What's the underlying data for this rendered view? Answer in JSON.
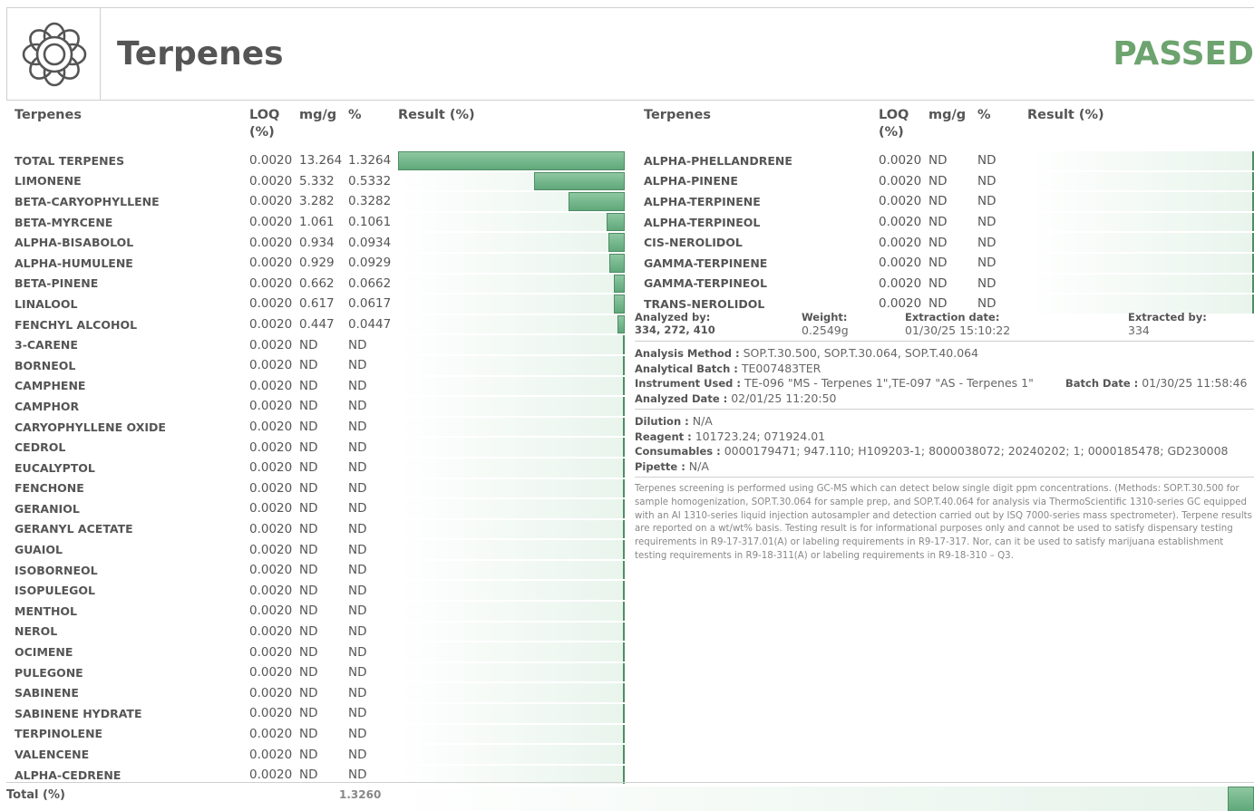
{
  "header": {
    "title": "Terpenes",
    "status": "PASSED",
    "status_color": "#6da36f",
    "icon": "flower-icon"
  },
  "columns": {
    "name": "Terpenes",
    "loq": "LOQ (%)",
    "mgg": "mg/g",
    "pct": "%",
    "result": "Result (%)"
  },
  "left_rows": [
    {
      "name": "TOTAL TERPENES",
      "loq": "0.0020",
      "mgg": "13.264",
      "pct": "1.3264",
      "result": 1.3264
    },
    {
      "name": "LIMONENE",
      "loq": "0.0020",
      "mgg": "5.332",
      "pct": "0.5332",
      "result": 0.5332
    },
    {
      "name": "BETA-CARYOPHYLLENE",
      "loq": "0.0020",
      "mgg": "3.282",
      "pct": "0.3282",
      "result": 0.3282
    },
    {
      "name": "BETA-MYRCENE",
      "loq": "0.0020",
      "mgg": "1.061",
      "pct": "0.1061",
      "result": 0.1061
    },
    {
      "name": "ALPHA-BISABOLOL",
      "loq": "0.0020",
      "mgg": "0.934",
      "pct": "0.0934",
      "result": 0.0934
    },
    {
      "name": "ALPHA-HUMULENE",
      "loq": "0.0020",
      "mgg": "0.929",
      "pct": "0.0929",
      "result": 0.0929
    },
    {
      "name": "BETA-PINENE",
      "loq": "0.0020",
      "mgg": "0.662",
      "pct": "0.0662",
      "result": 0.0662
    },
    {
      "name": "LINALOOL",
      "loq": "0.0020",
      "mgg": "0.617",
      "pct": "0.0617",
      "result": 0.0617
    },
    {
      "name": "FENCHYL ALCOHOL",
      "loq": "0.0020",
      "mgg": "0.447",
      "pct": "0.0447",
      "result": 0.0447
    },
    {
      "name": "3-CARENE",
      "loq": "0.0020",
      "mgg": "ND",
      "pct": "ND",
      "result": 0
    },
    {
      "name": "BORNEOL",
      "loq": "0.0020",
      "mgg": "ND",
      "pct": "ND",
      "result": 0
    },
    {
      "name": "CAMPHENE",
      "loq": "0.0020",
      "mgg": "ND",
      "pct": "ND",
      "result": 0
    },
    {
      "name": "CAMPHOR",
      "loq": "0.0020",
      "mgg": "ND",
      "pct": "ND",
      "result": 0
    },
    {
      "name": "CARYOPHYLLENE OXIDE",
      "loq": "0.0020",
      "mgg": "ND",
      "pct": "ND",
      "result": 0
    },
    {
      "name": "CEDROL",
      "loq": "0.0020",
      "mgg": "ND",
      "pct": "ND",
      "result": 0
    },
    {
      "name": "EUCALYPTOL",
      "loq": "0.0020",
      "mgg": "ND",
      "pct": "ND",
      "result": 0
    },
    {
      "name": "FENCHONE",
      "loq": "0.0020",
      "mgg": "ND",
      "pct": "ND",
      "result": 0
    },
    {
      "name": "GERANIOL",
      "loq": "0.0020",
      "mgg": "ND",
      "pct": "ND",
      "result": 0
    },
    {
      "name": "GERANYL ACETATE",
      "loq": "0.0020",
      "mgg": "ND",
      "pct": "ND",
      "result": 0
    },
    {
      "name": "GUAIOL",
      "loq": "0.0020",
      "mgg": "ND",
      "pct": "ND",
      "result": 0
    },
    {
      "name": "ISOBORNEOL",
      "loq": "0.0020",
      "mgg": "ND",
      "pct": "ND",
      "result": 0
    },
    {
      "name": "ISOPULEGOL",
      "loq": "0.0020",
      "mgg": "ND",
      "pct": "ND",
      "result": 0
    },
    {
      "name": "MENTHOL",
      "loq": "0.0020",
      "mgg": "ND",
      "pct": "ND",
      "result": 0
    },
    {
      "name": "NEROL",
      "loq": "0.0020",
      "mgg": "ND",
      "pct": "ND",
      "result": 0
    },
    {
      "name": "OCIMENE",
      "loq": "0.0020",
      "mgg": "ND",
      "pct": "ND",
      "result": 0
    },
    {
      "name": "PULEGONE",
      "loq": "0.0020",
      "mgg": "ND",
      "pct": "ND",
      "result": 0
    },
    {
      "name": "SABINENE",
      "loq": "0.0020",
      "mgg": "ND",
      "pct": "ND",
      "result": 0
    },
    {
      "name": "SABINENE HYDRATE",
      "loq": "0.0020",
      "mgg": "ND",
      "pct": "ND",
      "result": 0
    },
    {
      "name": "TERPINOLENE",
      "loq": "0.0020",
      "mgg": "ND",
      "pct": "ND",
      "result": 0
    },
    {
      "name": "VALENCENE",
      "loq": "0.0020",
      "mgg": "ND",
      "pct": "ND",
      "result": 0
    },
    {
      "name": "ALPHA-CEDRENE",
      "loq": "0.0020",
      "mgg": "ND",
      "pct": "ND",
      "result": 0
    }
  ],
  "right_rows": [
    {
      "name": "ALPHA-PHELLANDRENE",
      "loq": "0.0020",
      "mgg": "ND",
      "pct": "ND",
      "result": 0
    },
    {
      "name": "ALPHA-PINENE",
      "loq": "0.0020",
      "mgg": "ND",
      "pct": "ND",
      "result": 0
    },
    {
      "name": "ALPHA-TERPINENE",
      "loq": "0.0020",
      "mgg": "ND",
      "pct": "ND",
      "result": 0
    },
    {
      "name": "ALPHA-TERPINEOL",
      "loq": "0.0020",
      "mgg": "ND",
      "pct": "ND",
      "result": 0
    },
    {
      "name": "CIS-NEROLIDOL",
      "loq": "0.0020",
      "mgg": "ND",
      "pct": "ND",
      "result": 0
    },
    {
      "name": "GAMMA-TERPINENE",
      "loq": "0.0020",
      "mgg": "ND",
      "pct": "ND",
      "result": 0
    },
    {
      "name": "GAMMA-TERPINEOL",
      "loq": "0.0020",
      "mgg": "ND",
      "pct": "ND",
      "result": 0
    },
    {
      "name": "TRANS-NEROLIDOL",
      "loq": "0.0020",
      "mgg": "ND",
      "pct": "ND",
      "result": 0
    }
  ],
  "result_scale_max": 1.3264,
  "analysis": {
    "analyzed_by_label": "Analyzed by:",
    "analyzed_by": "334, 272, 410",
    "weight_label": "Weight:",
    "weight": "0.2549g",
    "extraction_date_label": "Extraction date:",
    "extraction_date": "01/30/25 15:10:22",
    "extracted_by_label": "Extracted by:",
    "extracted_by": "334"
  },
  "method": {
    "analysis_method_label": "Analysis Method :",
    "analysis_method": "SOP.T.30.500, SOP.T.30.064, SOP.T.40.064",
    "batch_label": "Analytical Batch :",
    "batch": "TE007483TER",
    "instrument_label": "Instrument Used :",
    "instrument": "TE-096 \"MS - Terpenes 1\",TE-097 \"AS - Terpenes 1\"",
    "batch_date_label": "Batch Date :",
    "batch_date": "01/30/25 11:58:46",
    "analyzed_date_label": "Analyzed Date :",
    "analyzed_date": "02/01/25 11:20:50"
  },
  "reagents": {
    "dilution_label": "Dilution :",
    "dilution": "N/A",
    "reagent_label": "Reagent :",
    "reagent": "101723.24; 071924.01",
    "consumables_label": "Consumables :",
    "consumables": "0000179471; 947.110; H109203-1; 8000038072; 20240202; 1; 0000185478; GD230008",
    "pipette_label": "Pipette :",
    "pipette": "N/A"
  },
  "description": "Terpenes screening is performed using GC-MS which can detect below single digit ppm concentrations. (Methods: SOP.T.30.500 for sample homogenization, SOP.T.30.064 for sample prep, and SOP.T.40.064 for analysis via ThermoScientific 1310-series GC equipped with an AI 1310-series liquid injection autosampler and detection carried out by ISQ 7000-series mass spectrometer). Terpene results are reported on a wt/wt% basis. Testing result is for informational purposes only and cannot be used to satisfy dispensary testing requirements in R9-17-317.01(A) or labeling requirements in R9-17-317. Nor, can it be used to satisfy marijuana establishment testing requirements in R9-18-311(A) or labeling requirements in R9-18-310 – Q3.",
  "footer": {
    "label": "Total (%)",
    "total": "1.3260"
  }
}
